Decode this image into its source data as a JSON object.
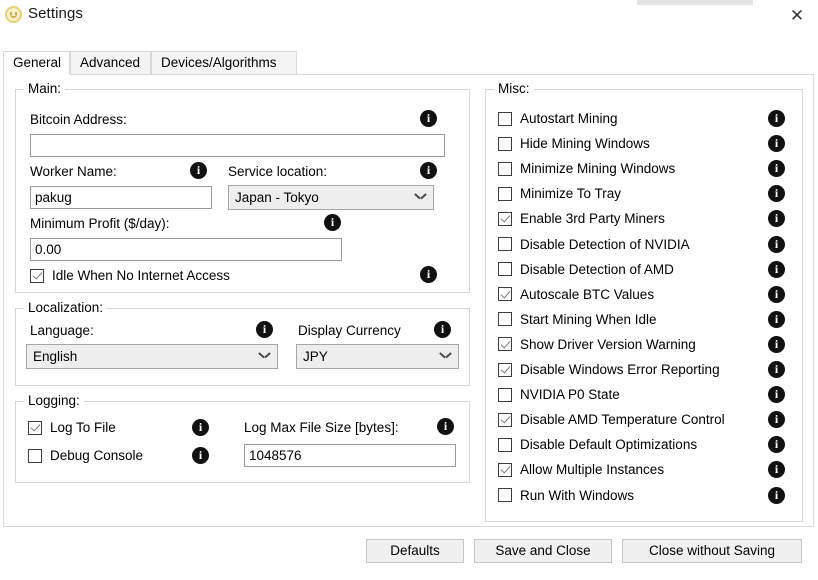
{
  "window": {
    "title": "Settings",
    "icon": "app-logo-icon",
    "close_label": "✕"
  },
  "tabs": [
    {
      "id": "general",
      "label": "General",
      "active": true
    },
    {
      "id": "advanced",
      "label": "Advanced",
      "active": false
    },
    {
      "id": "devices",
      "label": "Devices/Algorithms",
      "active": false
    }
  ],
  "groups": {
    "main": {
      "legend": "Main:",
      "bitcoin_address": {
        "label": "Bitcoin Address:",
        "value": "",
        "placeholder": ""
      },
      "worker_name": {
        "label": "Worker Name:",
        "value": "pakug",
        "placeholder": ""
      },
      "service_location": {
        "label": "Service location:",
        "value": "Japan - Tokyo"
      },
      "minimum_profit": {
        "label": "Minimum Profit ($/day):",
        "value": "0.00",
        "placeholder": ""
      },
      "idle_when_no_internet": {
        "label": "Idle When No Internet Access",
        "checked": true
      }
    },
    "localization": {
      "legend": "Localization:",
      "language": {
        "label": "Language:",
        "value": "English"
      },
      "display_currency": {
        "label": "Display Currency",
        "value": "JPY"
      }
    },
    "logging": {
      "legend": "Logging:",
      "log_to_file": {
        "label": "Log To File",
        "checked": true
      },
      "debug_console": {
        "label": "Debug Console",
        "checked": false
      },
      "log_max_file_size": {
        "label": "Log Max File Size [bytes]:",
        "value": "1048576",
        "placeholder": ""
      }
    },
    "misc": {
      "legend": "Misc:",
      "items": [
        {
          "label": "Autostart Mining",
          "checked": false
        },
        {
          "label": "Hide Mining Windows",
          "checked": false
        },
        {
          "label": "Minimize Mining Windows",
          "checked": false
        },
        {
          "label": "Minimize To Tray",
          "checked": false
        },
        {
          "label": "Enable 3rd Party Miners",
          "checked": true
        },
        {
          "label": "Disable Detection of NVIDIA",
          "checked": false
        },
        {
          "label": "Disable Detection of AMD",
          "checked": false
        },
        {
          "label": "Autoscale BTC Values",
          "checked": true
        },
        {
          "label": "Start Mining When Idle",
          "checked": false
        },
        {
          "label": "Show Driver Version Warning",
          "checked": true
        },
        {
          "label": "Disable Windows Error Reporting",
          "checked": true
        },
        {
          "label": "NVIDIA P0 State",
          "checked": false
        },
        {
          "label": "Disable AMD Temperature Control",
          "checked": true
        },
        {
          "label": "Disable Default Optimizations",
          "checked": false
        },
        {
          "label": "Allow Multiple Instances",
          "checked": true
        },
        {
          "label": "Run With Windows",
          "checked": false
        }
      ]
    }
  },
  "info_icon_glyph": "i",
  "buttons": {
    "defaults": "Defaults",
    "save_and_close": "Save and Close",
    "close_without_saving": "Close without Saving"
  },
  "colors": {
    "window_bg": "#ffffff",
    "group_border": "#d6d6d6",
    "input_border": "#9b9b9b",
    "combo_bg": "#eeeeee",
    "button_bg": "#f0f0f0",
    "info_icon_bg": "#111111",
    "app_icon": "#e8d27a"
  }
}
